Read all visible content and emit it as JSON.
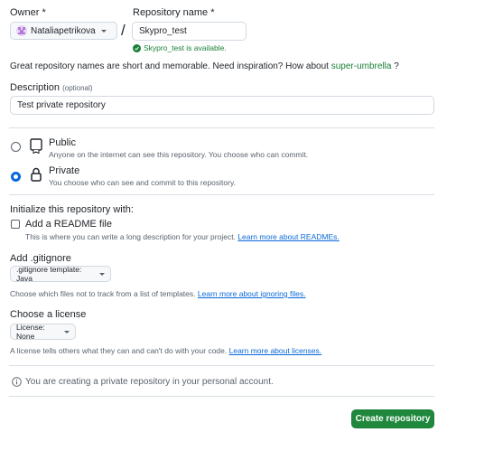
{
  "owner": {
    "label": "Owner *",
    "value": "Nataliapetrikova"
  },
  "separator": "/",
  "repo": {
    "label": "Repository name *",
    "value": "Skypro_test",
    "availability": "Skypro_test is available."
  },
  "inspiration": {
    "text": "Great repository names are short and memorable. Need inspiration? How about",
    "suggestion": "super-umbrella",
    "suffix": "?"
  },
  "description": {
    "label": "Description",
    "optional": "(optional)",
    "value": "Test private repository"
  },
  "visibility": {
    "public": {
      "label": "Public",
      "note": "Anyone on the internet can see this repository. You choose who can commit.",
      "selected": false
    },
    "private": {
      "label": "Private",
      "note": "You choose who can see and commit to this repository.",
      "selected": true
    }
  },
  "init": {
    "heading": "Initialize this repository with:",
    "readme_label": "Add a README file",
    "readme_note": "This is where you can write a long description for your project.",
    "readme_link": "Learn more about READMEs.",
    "readme_checked": false
  },
  "gitignore": {
    "heading": "Add .gitignore",
    "select": ".gitignore template: Java",
    "note": "Choose which files not to track from a list of templates.",
    "link": "Learn more about ignoring files."
  },
  "license": {
    "heading": "Choose a license",
    "select": "License: None",
    "note": "A license tells others what they can and can't do with your code.",
    "link": "Learn more about licenses."
  },
  "notice": "You are creating a private repository in your personal account.",
  "create_button": "Create repository",
  "colors": {
    "accent": "#0969da",
    "success": "#1a7f37",
    "button": "#1f883d"
  }
}
